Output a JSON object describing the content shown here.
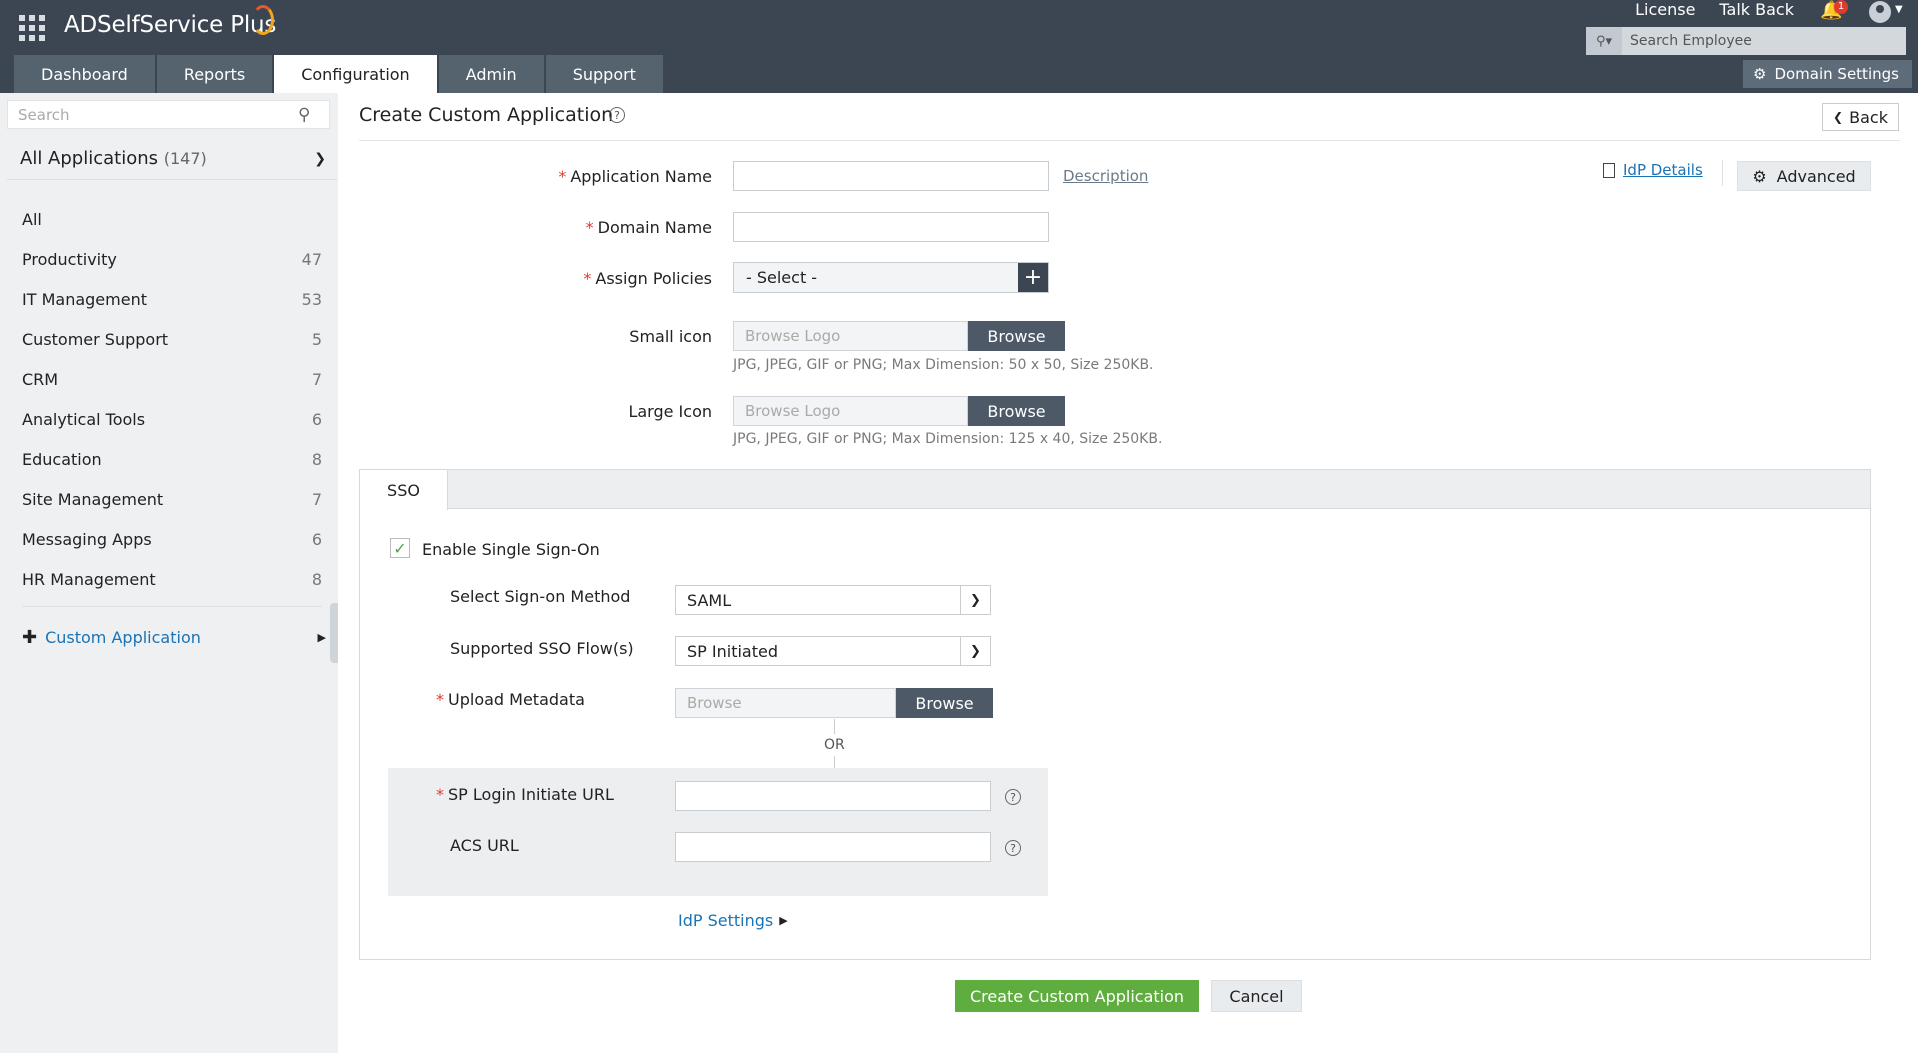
{
  "app": {
    "brand": "ADSelfService Plus",
    "top_links": [
      "License",
      "Talk Back"
    ],
    "notification_count": "1",
    "employee_search_placeholder": "Search Employee",
    "domain_settings": "Domain Settings"
  },
  "nav": {
    "tabs": [
      {
        "label": "Dashboard",
        "active": false
      },
      {
        "label": "Reports",
        "active": false
      },
      {
        "label": "Configuration",
        "active": true
      },
      {
        "label": "Admin",
        "active": false
      },
      {
        "label": "Support",
        "active": false
      }
    ]
  },
  "sidebar": {
    "search_placeholder": "Search",
    "all_apps_label": "All Applications",
    "all_apps_count": "(147)",
    "items": [
      {
        "label": "All",
        "count": ""
      },
      {
        "label": "Productivity",
        "count": "47"
      },
      {
        "label": "IT Management",
        "count": "53"
      },
      {
        "label": "Customer Support",
        "count": "5"
      },
      {
        "label": "CRM",
        "count": "7"
      },
      {
        "label": "Analytical Tools",
        "count": "6"
      },
      {
        "label": "Education",
        "count": "8"
      },
      {
        "label": "Site Management",
        "count": "7"
      },
      {
        "label": "Messaging Apps",
        "count": "6"
      },
      {
        "label": "HR Management",
        "count": "8"
      }
    ],
    "custom_app": "Custom Application"
  },
  "page": {
    "title": "Create Custom Application",
    "back": "Back",
    "idp_details": "IdP Details",
    "advanced": "Advanced"
  },
  "form": {
    "app_name_label": "Application Name",
    "description_link": "Description",
    "domain_name_label": "Domain Name",
    "assign_policies_label": "Assign Policies",
    "assign_policies_value": "- Select -",
    "small_icon_label": "Small icon",
    "large_icon_label": "Large Icon",
    "browse_logo_placeholder": "Browse Logo",
    "browse": "Browse",
    "small_icon_hint": "JPG, JPEG, GIF or PNG; Max Dimension: 50 x 50, Size 250KB.",
    "large_icon_hint": "JPG, JPEG, GIF or PNG; Max Dimension: 125 x 40, Size 250KB."
  },
  "sso": {
    "tab": "SSO",
    "enable_label": "Enable Single Sign-On",
    "enabled": true,
    "method_label": "Select Sign-on Method",
    "method_value": "SAML",
    "flow_label": "Supported SSO Flow(s)",
    "flow_value": "SP Initiated",
    "metadata_label": "Upload Metadata",
    "metadata_placeholder": "Browse",
    "metadata_browse": "Browse",
    "or": "OR",
    "sp_login_label": "SP Login Initiate URL",
    "acs_label": "ACS URL",
    "idp_settings": "IdP Settings"
  },
  "actions": {
    "create": "Create Custom Application",
    "cancel": "Cancel"
  },
  "colors": {
    "header_bg": "#3b4652",
    "accent_link": "#1a73b5",
    "create_button": "#5fad3f",
    "required": "#e03a2f"
  }
}
